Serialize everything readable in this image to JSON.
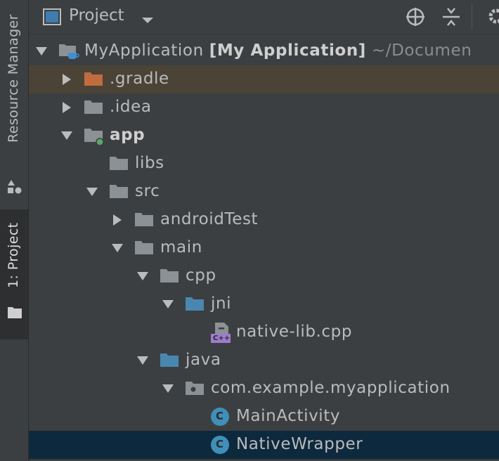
{
  "side_tabs": [
    {
      "label": "Resource Manager",
      "icon": "resource-manager-icon"
    },
    {
      "label": "1: Project",
      "icon": "project-folder-icon"
    }
  ],
  "header": {
    "title": "Project",
    "icons": [
      "project-view-icon",
      "dropdown-arrow-icon",
      "locate-icon",
      "collapse-all-icon",
      "gear-icon"
    ]
  },
  "tree": [
    {
      "name": "MyApplication",
      "module": "[My Application]",
      "path": "~/Documen",
      "depth": 0,
      "expanded": true,
      "icon": "project-module-icon"
    },
    {
      "name": ".gradle",
      "depth": 1,
      "expanded": false,
      "icon": "folder-orange-icon",
      "highlighted": true
    },
    {
      "name": ".idea",
      "depth": 1,
      "expanded": false,
      "icon": "folder-icon"
    },
    {
      "name": "app",
      "depth": 1,
      "expanded": true,
      "icon": "module-folder-icon"
    },
    {
      "name": "libs",
      "depth": 2,
      "icon": "folder-icon"
    },
    {
      "name": "src",
      "depth": 2,
      "expanded": true,
      "icon": "folder-icon"
    },
    {
      "name": "androidTest",
      "depth": 3,
      "expanded": false,
      "icon": "folder-icon"
    },
    {
      "name": "main",
      "depth": 3,
      "expanded": true,
      "icon": "folder-icon"
    },
    {
      "name": "cpp",
      "depth": 4,
      "expanded": true,
      "icon": "folder-icon"
    },
    {
      "name": "jni",
      "depth": 5,
      "expanded": true,
      "icon": "folder-blue-icon"
    },
    {
      "name": "native-lib.cpp",
      "depth": 6,
      "icon": "cpp-file-icon",
      "badge": "C++"
    },
    {
      "name": "java",
      "depth": 4,
      "expanded": true,
      "icon": "folder-blue-icon"
    },
    {
      "name": "com.example.myapplication",
      "depth": 5,
      "expanded": true,
      "icon": "package-icon"
    },
    {
      "name": "MainActivity",
      "depth": 6,
      "icon": "class-icon",
      "badge": "C"
    },
    {
      "name": "NativeWrapper",
      "depth": 6,
      "icon": "class-icon",
      "badge": "C",
      "selected": true
    }
  ],
  "colors": {
    "background": "#3c3f41",
    "highlight": "#4a4336",
    "selected": "#0d293e",
    "folder": "#8c9196",
    "source_folder": "#4a87b0",
    "gradle_folder": "#c06c3e",
    "class_badge": "#3f8fb8",
    "module_dot": "#59a869"
  }
}
